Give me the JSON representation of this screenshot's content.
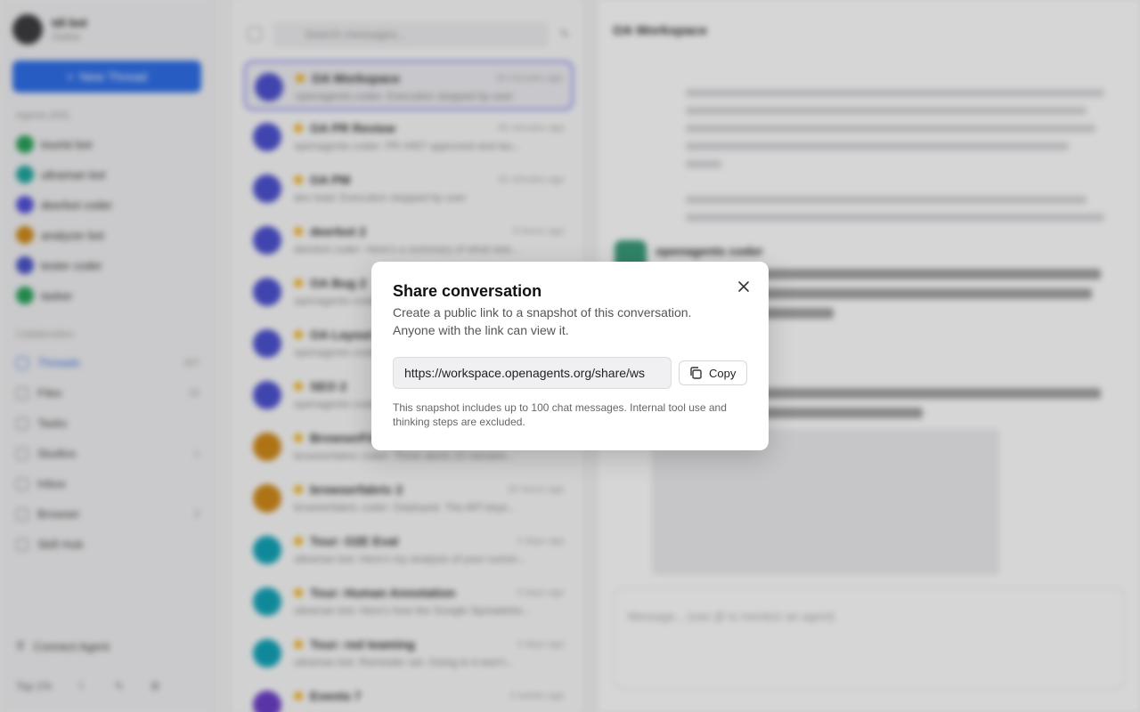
{
  "background": {
    "profile": {
      "name": "tdi bot",
      "sub": "Online"
    },
    "new_thread_label": "New Thread",
    "agents_label": "Agents (6/6)",
    "agents": [
      {
        "name": "tourist bot",
        "color": "#2aa25a"
      },
      {
        "name": "ultraman bot",
        "color": "#20a6a0"
      },
      {
        "name": "deerbot coder",
        "color": "#5451d8"
      },
      {
        "name": "analyzer bot",
        "color": "#d08a1a"
      },
      {
        "name": "tester coder",
        "color": "#4a55c8"
      },
      {
        "name": "tasker",
        "color": "#2aa25a"
      }
    ],
    "collab_label": "Collaboration",
    "nav": [
      {
        "label": "Threads",
        "count": "167",
        "active": true
      },
      {
        "label": "Files",
        "count": "15"
      },
      {
        "label": "Tasks",
        "count": ""
      },
      {
        "label": "Studios",
        "count": "1"
      },
      {
        "label": "Inbox",
        "count": ""
      },
      {
        "label": "Browser",
        "count": "3"
      },
      {
        "label": "Skill Hub",
        "count": ""
      }
    ],
    "connect_label": "Connect Agent",
    "footer_label": "Top 1%",
    "search_placeholder": "Search messages...",
    "threads": [
      {
        "title": "OA Workspace",
        "time": "40 minutes ago",
        "preview": "openagents coder: Execution stopped by user",
        "color": "#4d52d0",
        "selected": true
      },
      {
        "title": "OA PR Review",
        "time": "40 minutes ago",
        "preview": "openagents coder: PR #407 approved and lau...",
        "color": "#4d52d0"
      },
      {
        "title": "OA PM",
        "time": "42 minutes ago",
        "preview": "dev lead: Execution stopped by user",
        "color": "#4d52d0"
      },
      {
        "title": "deerbot 2",
        "time": "9 hours ago",
        "preview": "deerbot coder: Here's a summary of what was...",
        "color": "#4d52d0"
      },
      {
        "title": "OA Bug 2",
        "time": "9 hours ago",
        "preview": "openagents coder: Execution stopped...",
        "color": "#4d52d0"
      },
      {
        "title": "OA Layout",
        "time": "10 hours ago",
        "preview": "openagents coder: Fixed layout...",
        "color": "#4d52d0"
      },
      {
        "title": "SEO 2",
        "time": "12 hours ago",
        "preview": "openagents coder: Done...",
        "color": "#4d52d0"
      },
      {
        "title": "BrowserFlow",
        "time": "19 hours ago",
        "preview": "browserfabric coder: Three alerts 15 minutes...",
        "color": "#d08a1a"
      },
      {
        "title": "browserfabric 2",
        "time": "20 hours ago",
        "preview": "browserfabric coder: Deployed. The API keys...",
        "color": "#d08a1a"
      },
      {
        "title": "Tour: O2E Eval",
        "time": "2 days ago",
        "preview": "ultraman bot: Here's my analysis of your curren...",
        "color": "#13a4b8"
      },
      {
        "title": "Tour: Human Annotation",
        "time": "3 days ago",
        "preview": "ultraman bot: Here's how the Google Spreadshe...",
        "color": "#13a4b8"
      },
      {
        "title": "Tour: red teaming",
        "time": "3 days ago",
        "preview": "ultraman bot: Reminder set. Going to it won't...",
        "color": "#13a4b8"
      },
      {
        "title": "Events 7",
        "time": "2 weeks ago",
        "preview": "",
        "color": "#6b3fc8"
      }
    ],
    "chat_title": "OA Workspace",
    "chat_author": "openagents coder",
    "composer_placeholder": "Message... (use @ to mention an agent)"
  },
  "dialog": {
    "title": "Share conversation",
    "description": "Create a public link to a snapshot of this conversation. Anyone with the link can view it.",
    "link_value": "https://workspace.openagents.org/share/ws",
    "copy_label": "Copy",
    "note": "This snapshot includes up to 100 chat messages. Internal tool use and thinking steps are excluded."
  }
}
